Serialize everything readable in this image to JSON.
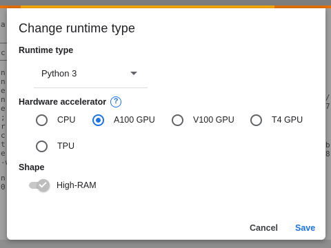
{
  "dialog": {
    "title": "Change runtime type",
    "runtime_type": {
      "label": "Runtime type",
      "selected": "Python 3"
    },
    "hardware_accelerator": {
      "label": "Hardware accelerator",
      "help_icon": "question-circle-icon",
      "options": [
        {
          "label": "CPU",
          "checked": false
        },
        {
          "label": "A100 GPU",
          "checked": true
        },
        {
          "label": "V100 GPU",
          "checked": false
        },
        {
          "label": "T4 GPU",
          "checked": false
        },
        {
          "label": "TPU",
          "checked": false
        }
      ]
    },
    "shape": {
      "label": "Shape",
      "toggle_label": "High-RAM",
      "toggle_on": true,
      "toggle_disabled": true
    },
    "buttons": {
      "cancel": "Cancel",
      "save": "Save"
    }
  },
  "background": {
    "left_fragments": [
      "a",
      "c",
      "n",
      "n",
      "e",
      "n",
      "e",
      ";",
      "r",
      "c",
      "t",
      "e",
      "-w",
      "",
      "n",
      "0"
    ],
    "right_fragments": [
      "/",
      "7",
      "b",
      "8"
    ]
  },
  "colors": {
    "accent": "#1a73e8",
    "top_bar_orange": "#e8710a",
    "top_bar_yellow": "#f9ab00"
  }
}
